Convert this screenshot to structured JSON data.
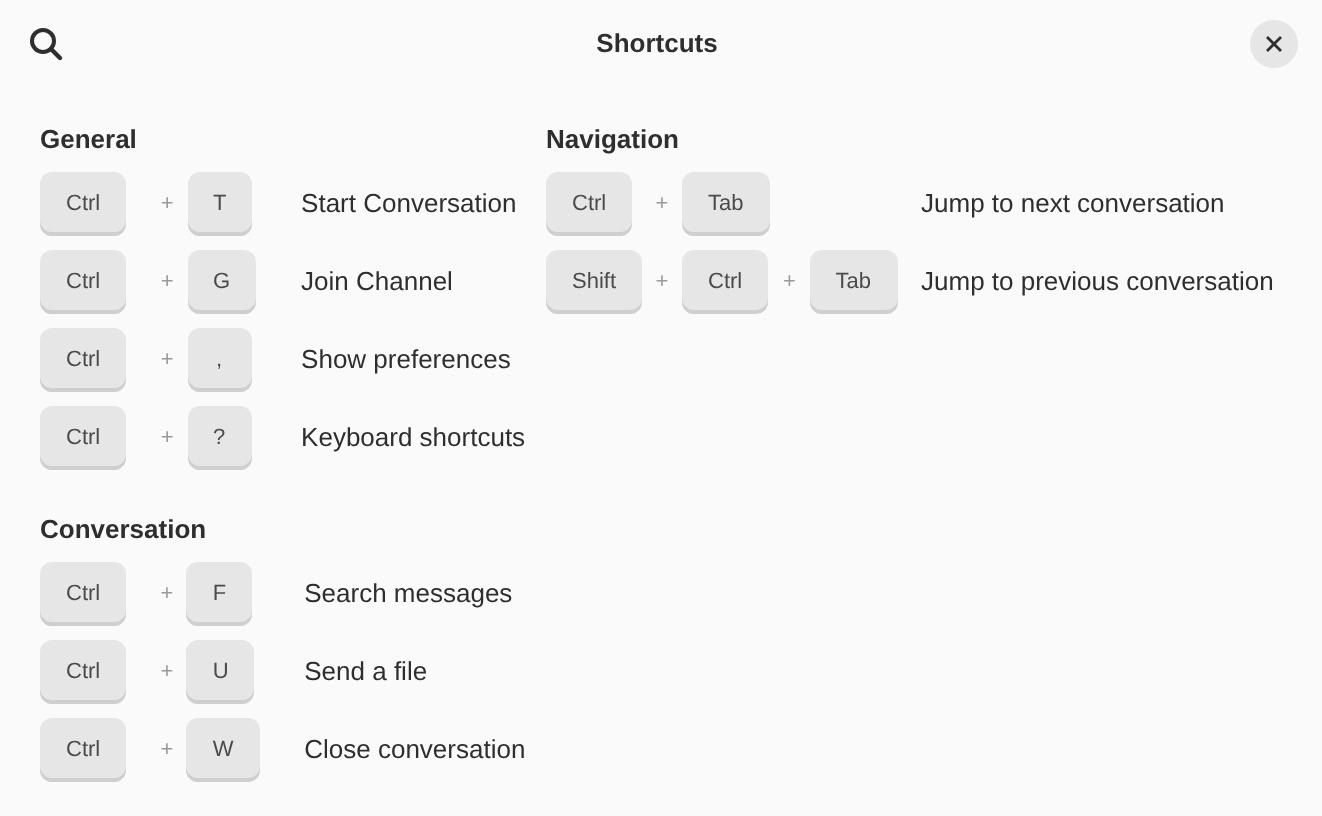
{
  "window": {
    "title": "Shortcuts"
  },
  "columns": [
    [
      {
        "title": "General",
        "shortcuts": [
          {
            "keys": [
              "Ctrl",
              "T"
            ],
            "description": "Start Conversation"
          },
          {
            "keys": [
              "Ctrl",
              "G"
            ],
            "description": "Join Channel"
          },
          {
            "keys": [
              "Ctrl",
              ","
            ],
            "description": "Show preferences"
          },
          {
            "keys": [
              "Ctrl",
              "?"
            ],
            "description": "Keyboard shortcuts"
          }
        ]
      },
      {
        "title": "Conversation",
        "shortcuts": [
          {
            "keys": [
              "Ctrl",
              "F"
            ],
            "description": "Search messages"
          },
          {
            "keys": [
              "Ctrl",
              "U"
            ],
            "description": "Send a file"
          },
          {
            "keys": [
              "Ctrl",
              "W"
            ],
            "description": "Close conversation"
          }
        ]
      }
    ],
    [
      {
        "title": "Navigation",
        "shortcuts": [
          {
            "keys": [
              "Ctrl",
              "Tab"
            ],
            "description": "Jump to next conversation"
          },
          {
            "keys": [
              "Shift",
              "Ctrl",
              "Tab"
            ],
            "description": "Jump to previous conversation"
          }
        ]
      }
    ]
  ],
  "plus": "+"
}
